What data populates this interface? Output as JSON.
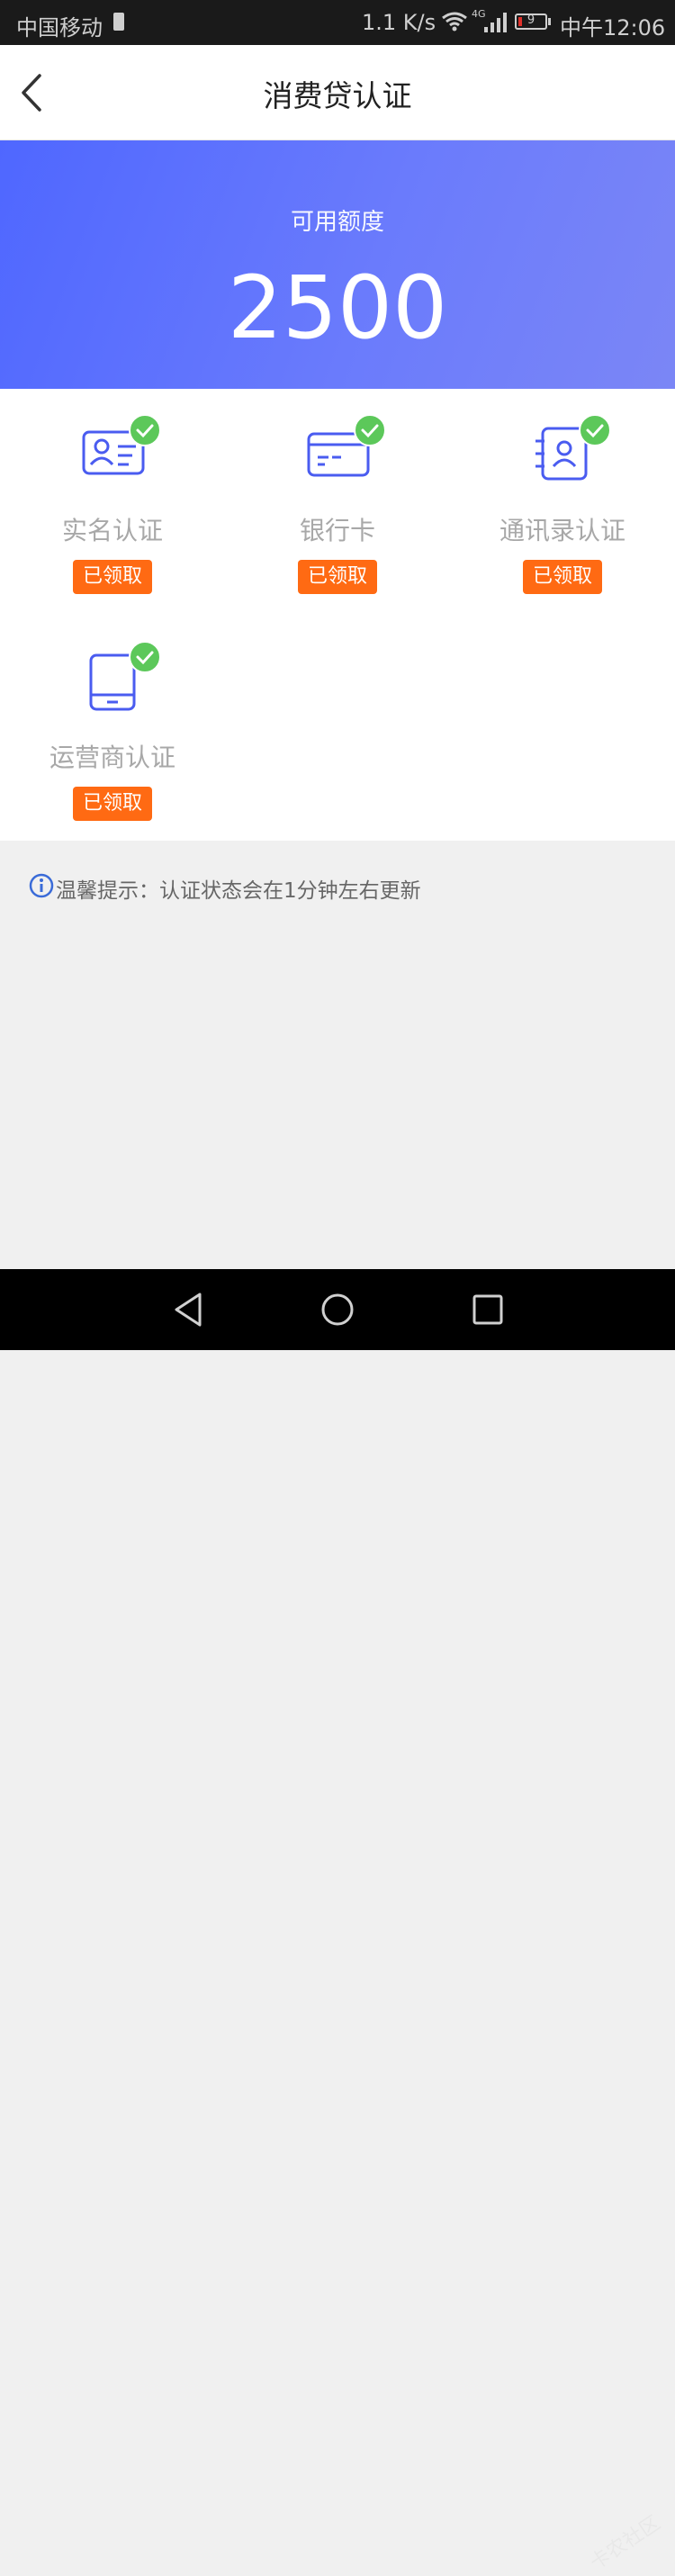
{
  "status_bar": {
    "carrier": "中国移动",
    "net_speed": "1.1 K/s",
    "network_type": "4G",
    "battery_level": "9",
    "time": "中午12:06"
  },
  "nav": {
    "title": "消费贷认证"
  },
  "hero": {
    "label": "可用额度",
    "amount": "2500"
  },
  "cards": [
    {
      "label": "实名认证",
      "badge": "已领取",
      "icon": "id-card-icon",
      "verified": true
    },
    {
      "label": "银行卡",
      "badge": "已领取",
      "icon": "bank-card-icon",
      "verified": true
    },
    {
      "label": "通讯录认证",
      "badge": "已领取",
      "icon": "contacts-book-icon",
      "verified": true
    },
    {
      "label": "运营商认证",
      "badge": "已领取",
      "icon": "phone-device-icon",
      "verified": true
    }
  ],
  "tip": {
    "text": "温馨提示：认证状态会在1分钟左右更新"
  },
  "watermark": "卡农社区",
  "colors": {
    "accent_blue": "#4f67ff",
    "badge_orange": "#ff6a13",
    "check_green": "#5cc85a",
    "icon_blue": "#4a5cf0"
  }
}
